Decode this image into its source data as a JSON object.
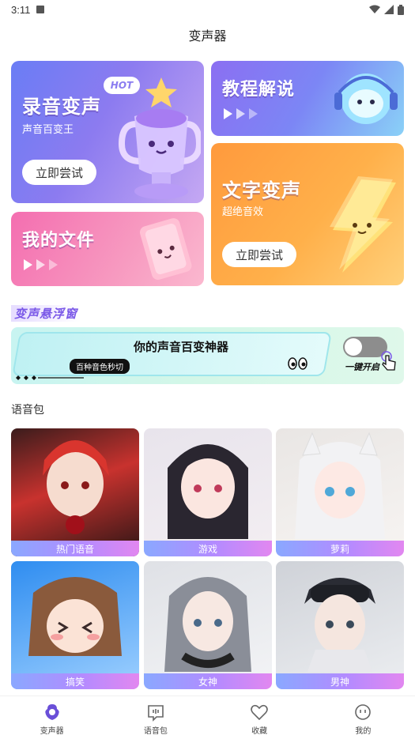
{
  "status": {
    "time": "3:11"
  },
  "header": {
    "title": "变声器"
  },
  "cards": {
    "record": {
      "title": "录音变声",
      "subtitle": "声音百变王",
      "badge": "HOT",
      "button": "立即尝试"
    },
    "tutorial": {
      "title": "教程解说"
    },
    "myfiles": {
      "title": "我的文件"
    },
    "text": {
      "title": "文字变声",
      "subtitle": "超绝音效",
      "button": "立即尝试"
    }
  },
  "float_window": {
    "section_title": "变声悬浮窗",
    "headline": "你的声音百变神器",
    "tag": "百种音色秒切",
    "toggle_label": "一键开启",
    "toggle_on": false
  },
  "voice_packs": {
    "section_title": "语音包",
    "items": [
      {
        "label": "热门语音"
      },
      {
        "label": "游戏"
      },
      {
        "label": "萝莉"
      },
      {
        "label": "搞笑"
      },
      {
        "label": "女神"
      },
      {
        "label": "男神"
      }
    ]
  },
  "tabbar": {
    "items": [
      {
        "label": "变声器",
        "icon": "voice-changer-icon",
        "active": true
      },
      {
        "label": "语音包",
        "icon": "voice-pack-icon",
        "active": false
      },
      {
        "label": "收藏",
        "icon": "heart-icon",
        "active": false
      },
      {
        "label": "我的",
        "icon": "profile-face-icon",
        "active": false
      }
    ]
  },
  "colors": {
    "accent": "#7a58e8",
    "record_card": "#6a7df5",
    "myfiles_card": "#f46eb0",
    "text_card": "#ff9a3d"
  }
}
